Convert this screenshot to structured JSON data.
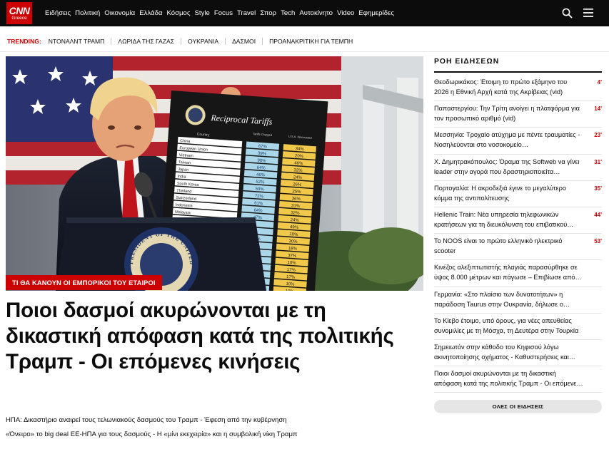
{
  "header": {
    "logo_main": "CNN",
    "logo_sub": "Greece",
    "nav": [
      "Ειδήσεις",
      "Πολιτική",
      "Οικονομία",
      "Ελλάδα",
      "Κόσμος",
      "Style",
      "Focus",
      "Travel",
      "Σπορ",
      "Tech",
      "Αυτοκίνητο",
      "Video",
      "Εφημερίδες"
    ],
    "search_icon": "search-icon",
    "menu_icon": "hamburger-menu-icon"
  },
  "trending": {
    "label": "TRENDING:",
    "items": [
      "ΝΤΟΝΑΛΝΤ ΤΡΑΜΠ",
      "ΛΩΡΙΔΑ ΤΗΣ ΓΑΖΑΣ",
      "ΟΥΚΡΑΝΙΑ",
      "ΔΑΣΜΟΙ",
      "ΠΡΟΑΝΑΚΡΙΤΙΚΗ ΓΙΑ ΤΕΜΠΗ"
    ]
  },
  "main": {
    "kicker": "ΤΙ ΘΑ ΚΑΝΟΥΝ ΟΙ ΕΜΠΟΡΙΚΟΙ ΤΟΥ ΕΤΑΙΡΟΙ",
    "headline": "Ποιοι δασμοί ακυρώνονται με τη δικαστική απόφαση κατά της πολιτικής Τραμπ - Οι επόμενες κινήσεις",
    "related": [
      "ΗΠΑ: Δικαστήριο αναιρεί τους τελωνιακούς δασμούς του Τραμπ - Έφεση από την κυβέρνηση",
      "«Όνειρο» το big deal ΕΕ-ΗΠΑ για τους δασμούς - Η «μίνι εκεχειρία» και η συμβολική νίκη Τραμπ"
    ],
    "image": {
      "board_title": "Reciprocal Tariffs",
      "col_country": "Country",
      "col_charged": "Tariffs Charged to the U.S.A.",
      "col_reciprocal": "U.S.A. Discounted Reciprocal Tariffs",
      "rows": [
        [
          "China",
          "67%",
          "34%"
        ],
        [
          "European Union",
          "39%",
          "20%"
        ],
        [
          "Vietnam",
          "90%",
          "46%"
        ],
        [
          "Taiwan",
          "64%",
          "32%"
        ],
        [
          "Japan",
          "46%",
          "24%"
        ],
        [
          "India",
          "52%",
          "26%"
        ],
        [
          "South Korea",
          "50%",
          "25%"
        ],
        [
          "Thailand",
          "72%",
          "36%"
        ],
        [
          "Switzerland",
          "61%",
          "31%"
        ],
        [
          "Indonesia",
          "64%",
          "32%"
        ],
        [
          "Malaysia",
          "47%",
          "24%"
        ],
        [
          "",
          "",
          "49%"
        ],
        [
          "",
          "",
          "10%"
        ],
        [
          "",
          "60%",
          "30%"
        ],
        [
          "",
          "36%",
          "18%"
        ],
        [
          "",
          "74%",
          "37%"
        ],
        [
          "",
          "10%",
          "10%"
        ],
        [
          "",
          "33%",
          "17%"
        ],
        [
          "",
          "34%",
          "17%"
        ],
        [
          "",
          "10%",
          "10%"
        ],
        [
          "",
          "10%",
          "10%"
        ]
      ],
      "seal_text": "PRESIDENT OF THE UNITED STATES"
    }
  },
  "sidebar": {
    "title": "ΡΟΗ ΕΙΔΗΣΕΩΝ",
    "items": [
      {
        "text": "Θεοδωρικάκος: Έτοιμη το πρώτο εξάμηνο του 2026 η Εθνική Αρχή κατά της Ακρίβειας (vid)",
        "time": "4'"
      },
      {
        "text": "Παπαστεργίου: Την Τρίτη ανοίγει η πλατφόρμα για τον προσωπικό αριθμό (vid)",
        "time": "14'"
      },
      {
        "text": "Μεσσηνία: Τροχαίο ατύχημα με πέντε τραυματίες - Νοσηλεύονται στο νοσοκομείο…",
        "time": "23'"
      },
      {
        "text": "Χ. Δημητρακόπουλος: Όραμα της Softweb να γίνει leader στην αγορά που δραστηριοποιείτα…",
        "time": "31'"
      },
      {
        "text": "Πορτογαλία: Η ακροδεξιά έγινε το μεγαλύτερο κόμμα της αντιπολίτευσης",
        "time": "35'"
      },
      {
        "text": "Hellenic Train: Νέα υπηρεσία τηλεφωνικών κρατήσεων για τη διευκόλυνση του επιβατικού…",
        "time": "44'"
      },
      {
        "text": "Το NOOS είναι το πρώτο ελληνικό ηλεκτρικό scooter",
        "time": "53'"
      },
      {
        "text": "Κινέζος αλεξιπτωτιστής πλαγιάς παρασύρθηκε σε ύψος 8.000 μέτρων και πάγωσε – Επιβίωσε από…",
        "time": ""
      },
      {
        "text": "Γερμανία: «Στο πλαίσιο των δυνατοτήτων» η παράδοση Taurus στην Ουκρανία, δήλωσε ο…",
        "time": ""
      },
      {
        "text": "Το Κίεβο έτοιμο, υπό όρους, για νέες απευθείας συνομιλίες με τη Μόσχα, τη Δευτέρα στην Τουρκία",
        "time": ""
      },
      {
        "text": "Σημειωτόν στην κάθοδο του Κηφισού λόγω ακινητοποίησης οχήματος - Καθυστερήσεις και στ…",
        "time": ""
      },
      {
        "text": "Ποιοι δασμοί ακυρώνονται με τη δικαστική απόφαση κατά της πολιτικής Τραμπ - Οι επόμενες κινήσεις",
        "time": ""
      }
    ],
    "all_news_button": "ΟΛΕΣ ΟΙ ΕΙΔΗΣΕΙΣ"
  },
  "colors": {
    "brand_red": "#cc0000",
    "header_bg": "#0c0c0c"
  }
}
